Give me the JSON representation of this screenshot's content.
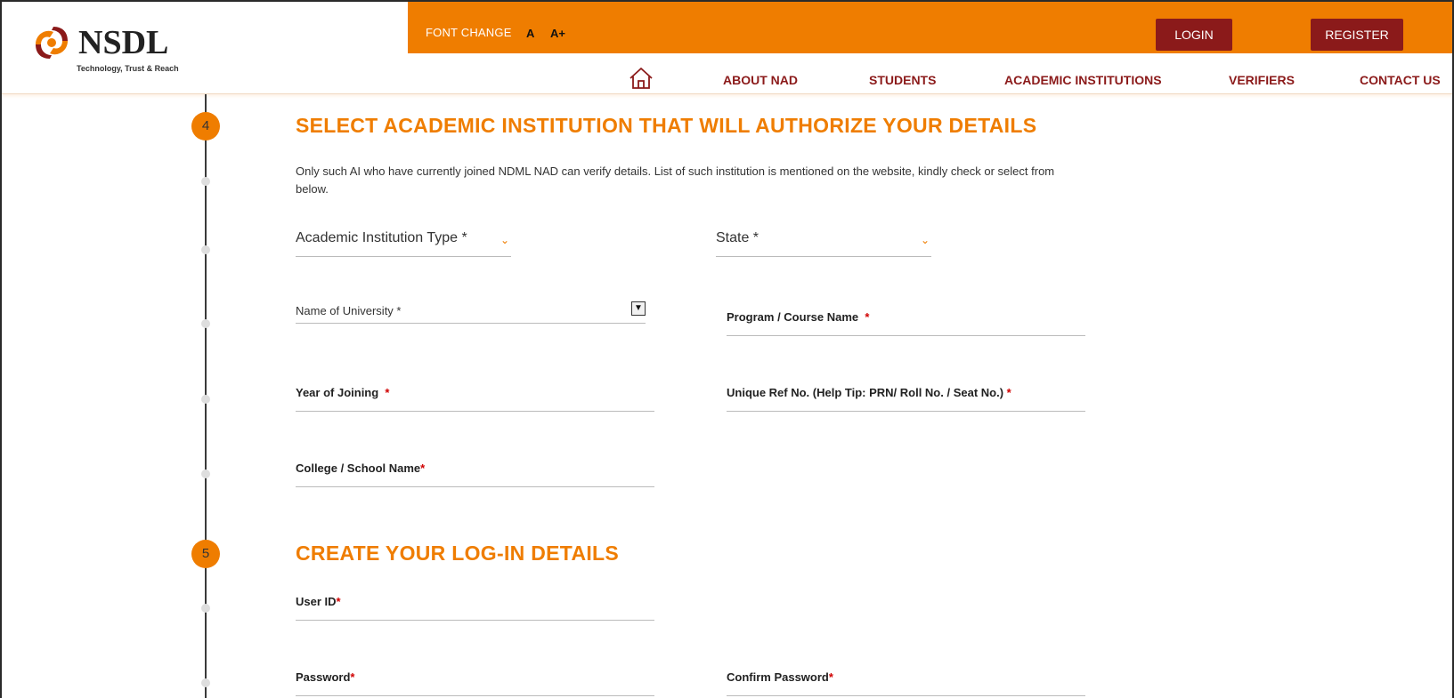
{
  "brand": {
    "name": "NSDL",
    "tagline": "Technology, Trust & Reach"
  },
  "topbar": {
    "font_change": "FONT CHANGE",
    "font_small": "A",
    "font_large": "A+",
    "login": "LOGIN",
    "register": "REGISTER"
  },
  "nav": {
    "items": [
      {
        "label": "ABOUT NAD"
      },
      {
        "label": "STUDENTS"
      },
      {
        "label": "ACADEMIC INSTITUTIONS"
      },
      {
        "label": "VERIFIERS"
      },
      {
        "label": "CONTACT US"
      }
    ]
  },
  "steps": {
    "step4": {
      "number": "4",
      "title": "SELECT ACADEMIC INSTITUTION THAT WILL AUTHORIZE YOUR DETAILS",
      "description": "Only such AI who have currently joined NDML NAD can verify details. List of such institution is mentioned on the website, kindly check or select from below."
    },
    "step5": {
      "number": "5",
      "title": "CREATE YOUR LOG-IN DETAILS"
    }
  },
  "form": {
    "institution_type": "Academic Institution Type *",
    "state": "State *",
    "university": "Name of University *",
    "program": "Program / Course Name",
    "year_joining": "Year of Joining",
    "unique_ref": "Unique Ref No.   (Help Tip: PRN/ Roll No. / Seat No.)",
    "college": "College / School Name",
    "user_id": "User ID",
    "password": "Password",
    "confirm_password": "Confirm Password",
    "required_mark": "*"
  },
  "colors": {
    "accent": "#ef7d00",
    "dark_button": "#8b1a1a",
    "required": "#d00000"
  }
}
